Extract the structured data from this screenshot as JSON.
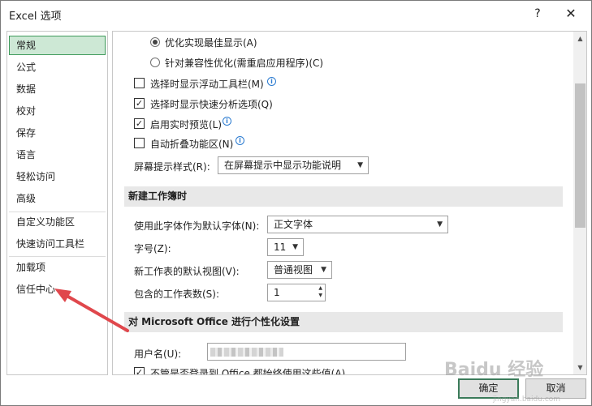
{
  "window": {
    "title": "Excel 选项",
    "help": "?",
    "close": "✕"
  },
  "sidebar": {
    "items": [
      {
        "label": "常规"
      },
      {
        "label": "公式"
      },
      {
        "label": "数据"
      },
      {
        "label": "校对"
      },
      {
        "label": "保存"
      },
      {
        "label": "语言"
      },
      {
        "label": "轻松访问"
      },
      {
        "label": "高级"
      },
      {
        "label": "自定义功能区"
      },
      {
        "label": "快速访问工具栏"
      },
      {
        "label": "加载项"
      },
      {
        "label": "信任中心"
      }
    ]
  },
  "content": {
    "radio_optimize_display": "优化实现最佳显示(A)",
    "radio_optimize_compat": "针对兼容性优化(需重启应用程序)(C)",
    "check_minitoolbar": "选择时显示浮动工具栏(M)",
    "check_quickanalysis": "选择时显示快速分析选项(Q)",
    "check_livepreview": "启用实时预览(L)",
    "check_collapse_ribbon": "自动折叠功能区(N)",
    "screentip_label": "屏幕提示样式(R):",
    "screentip_value": "在屏幕提示中显示功能说明",
    "section_new_workbook": "新建工作簿时",
    "default_font_label": "使用此字体作为默认字体(N):",
    "default_font_value": "正文字体",
    "font_size_label": "字号(Z):",
    "font_size_value": "11",
    "default_view_label": "新工作表的默认视图(V):",
    "default_view_value": "普通视图",
    "sheet_count_label": "包含的工作表数(S):",
    "sheet_count_value": "1",
    "section_personalize": "对 Microsoft Office 进行个性化设置",
    "username_label": "用户名(U):",
    "check_always_use": "不管是否登录到 Office 都始终使用这些值(A)"
  },
  "buttons": {
    "ok": "确定",
    "cancel": "取消"
  },
  "icons": {
    "info": "info-icon",
    "chevron": "chevron-down-icon"
  },
  "watermark": {
    "text": "Baidu 经验",
    "sub": "jingyan.baidu.com"
  },
  "colors": {
    "selected_bg": "#cde8d5",
    "selected_border": "#3f9a5b",
    "arrow": "#e0474c",
    "info": "#2b7bd0"
  }
}
